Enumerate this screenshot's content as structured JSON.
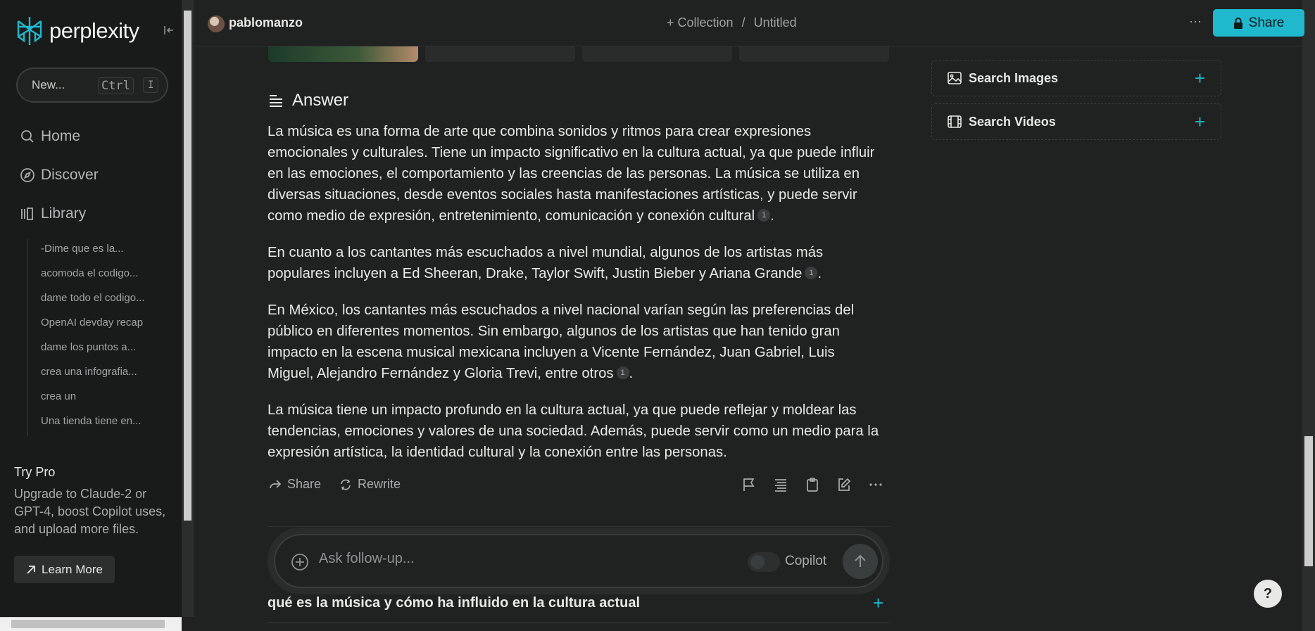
{
  "app": {
    "name": "perplexity",
    "accent": "#20b8cd"
  },
  "sidebar": {
    "new_label": "New...",
    "shortcut_ctrl": "Ctrl",
    "shortcut_key": "I",
    "nav": [
      {
        "label": "Home",
        "icon": "search-icon"
      },
      {
        "label": "Discover",
        "icon": "compass-icon"
      },
      {
        "label": "Library",
        "icon": "library-icon"
      }
    ],
    "history": [
      "-Dime que es la...",
      "acomoda el codigo...",
      "dame todo el codigo...",
      "OpenAI devday recap",
      "dame los puntos a...",
      "crea una infografia...",
      "crea un",
      "Una tienda tiene en..."
    ],
    "try_pro_title": "Try Pro",
    "try_pro_text": "Upgrade to Claude-2 or GPT-4, boost Copilot uses, and upload more files.",
    "learn_more": "Learn More"
  },
  "topbar": {
    "username": "pablomanzo",
    "collection": "+ Collection",
    "separator": "/",
    "title": "Untitled",
    "more": "···",
    "share": "Share"
  },
  "answer": {
    "heading": "Answer",
    "paragraphs": [
      "La música es una forma de arte que combina sonidos y ritmos para crear expresiones emocionales y culturales. Tiene un impacto significativo en la cultura actual, ya que puede influir en las emociones, el comportamiento y las creencias de las personas. La música se utiliza en diversas situaciones, desde eventos sociales hasta manifestaciones artísticas, y puede servir como medio de expresión, entretenimiento, comunicación y conexión cultural",
      "En cuanto a los cantantes más escuchados a nivel mundial, algunos de los artistas más populares incluyen a Ed Sheeran, Drake, Taylor Swift, Justin Bieber y Ariana Grande",
      "En México, los cantantes más escuchados a nivel nacional varían según las preferencias del público en diferentes momentos. Sin embargo, algunos de los artistas que han tenido gran impacto en la escena musical mexicana incluyen a Vicente Fernández, Juan Gabriel, Luis Miguel, Alejandro Fernández y Gloria Trevi, entre otros",
      "La música tiene un impacto profundo en la cultura actual, ya que puede reflejar y moldear las tendencias, emociones y valores de una sociedad. Además, puede servir como un medio para la expresión artística, la identidad cultural y la conexión entre las personas."
    ],
    "citation": "1",
    "period": ".",
    "share": "Share",
    "rewrite": "Rewrite"
  },
  "followup": {
    "placeholder": "Ask follow-up...",
    "copilot": "Copilot"
  },
  "related": {
    "item": "qué es la música y cómo ha influido en la cultura actual",
    "plus": "+"
  },
  "side": {
    "search_images": "Search Images",
    "search_videos": "Search Videos",
    "plus": "+"
  },
  "help": "?"
}
